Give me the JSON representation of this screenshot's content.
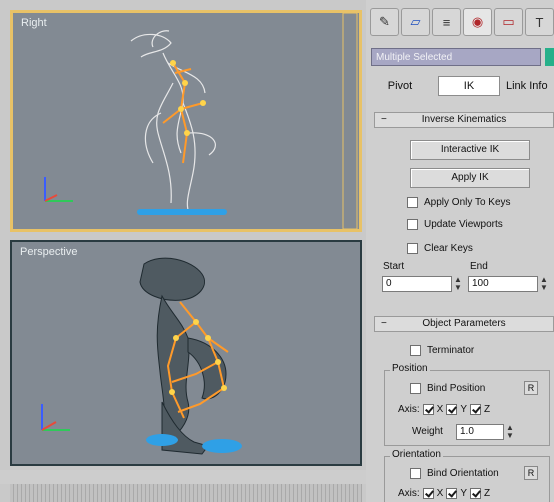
{
  "viewports": {
    "right": {
      "label": "Right"
    },
    "perspective": {
      "label": "Perspective"
    }
  },
  "command_panel": {
    "tabs": [
      {
        "icon": "create-icon",
        "glyph": "✎"
      },
      {
        "icon": "modify-icon",
        "glyph": "▱"
      },
      {
        "icon": "hierarchy-icon",
        "glyph": "≡"
      },
      {
        "icon": "motion-icon",
        "glyph": "◉"
      },
      {
        "icon": "display-icon",
        "glyph": "▭"
      },
      {
        "icon": "utilities-icon",
        "glyph": "T"
      }
    ],
    "object_name": "Multiple Selected",
    "name_color": "#26b08a",
    "subtabs": {
      "pivot": "Pivot",
      "ik": "IK",
      "link_info": "Link Info"
    },
    "inverse_kinematics": {
      "title": "Inverse Kinematics",
      "interactive_ik": "Interactive IK",
      "apply_ik": "Apply IK",
      "apply_only_to_keys": "Apply Only To Keys",
      "update_viewports": "Update Viewports",
      "clear_keys": "Clear Keys",
      "start_label": "Start",
      "end_label": "End",
      "start_value": "0",
      "end_value": "100"
    },
    "object_parameters": {
      "title": "Object Parameters",
      "terminator": "Terminator",
      "position_group": "Position",
      "bind_position": "Bind Position",
      "r_button": "R",
      "axis_label": "Axis:",
      "axes": [
        "X",
        "Y",
        "Z"
      ],
      "weight_label": "Weight",
      "weight_value": "1.0",
      "orientation_group": "Orientation",
      "bind_orientation": "Bind Orientation"
    }
  }
}
